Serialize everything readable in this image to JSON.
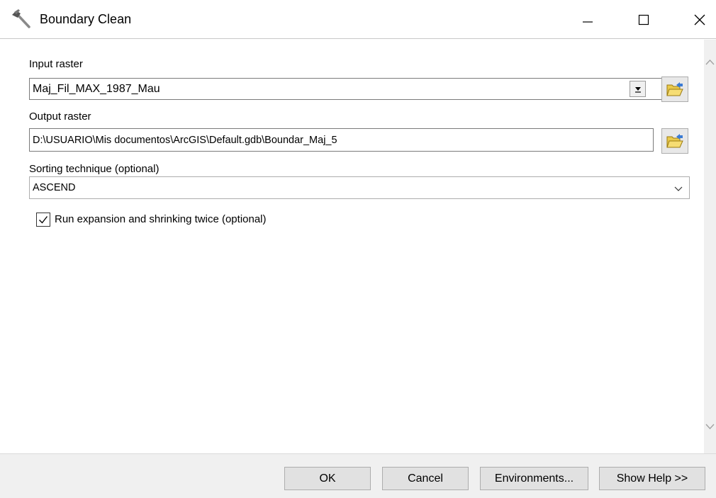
{
  "window": {
    "title": "Boundary Clean",
    "app_icon": "hammer-icon"
  },
  "form": {
    "input_raster": {
      "label": "Input raster",
      "value": "Maj_Fil_MAX_1987_Mau"
    },
    "output_raster": {
      "label": "Output raster",
      "value": "D:\\USUARIO\\Mis documentos\\ArcGIS\\Default.gdb\\Boundar_Maj_5"
    },
    "sorting_technique": {
      "label": "Sorting technique (optional)",
      "value": "ASCEND"
    },
    "run_twice": {
      "label": "Run expansion and shrinking twice (optional)",
      "checked": true
    }
  },
  "buttons": {
    "ok": "OK",
    "cancel": "Cancel",
    "environments": "Environments...",
    "show_help": "Show Help >>"
  },
  "colors": {
    "footer_bg": "#f0f0f0",
    "button_bg": "#e1e1e1",
    "folder_yellow": "#e9c94a"
  }
}
